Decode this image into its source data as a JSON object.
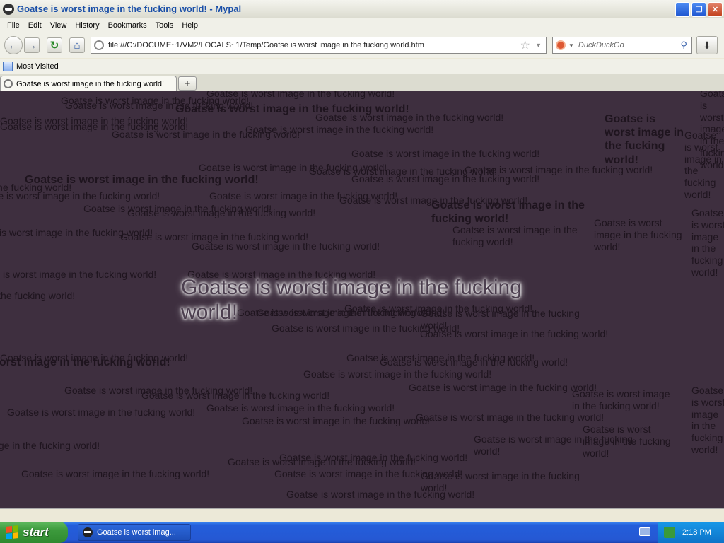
{
  "window": {
    "title": "Goatse is worst image in the fucking world! - Mypal",
    "min": "_",
    "max": "❐",
    "close": "✕"
  },
  "menu": [
    "File",
    "Edit",
    "View",
    "History",
    "Bookmarks",
    "Tools",
    "Help"
  ],
  "nav": {
    "back": "←",
    "forward": "→",
    "reload": "↻",
    "home": "⌂",
    "url": "file:///C:/DOCUME~1/VM2/LOCALS~1/Temp/Goatse is worst image in the fucking world.htm",
    "star": "☆",
    "drop": "▼",
    "search_placeholder": "DuckDuckGo",
    "search_glyph": "⚲",
    "download": "⬇"
  },
  "bookmarks": {
    "most_visited": "Most Visited"
  },
  "tabs": [
    {
      "label": "Goatse is worst image in the fucking world!"
    }
  ],
  "newtab": "+",
  "content": {
    "phrase": "Goatse is worst image in the fucking world!",
    "fragment_world": "world!",
    "hero": "Goatse is worst image in the fucking world!",
    "bg_color": "#3e2f3f"
  },
  "taskbar": {
    "start": "start",
    "task": "Goatse is worst imag...",
    "clock": "2:18 PM"
  }
}
